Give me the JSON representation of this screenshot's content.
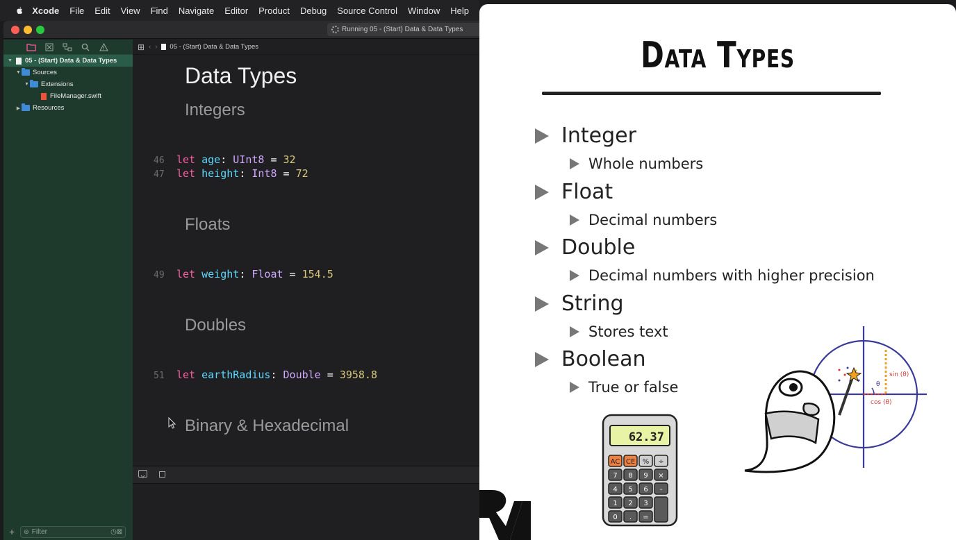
{
  "menubar": {
    "items": [
      "Xcode",
      "File",
      "Edit",
      "View",
      "Find",
      "Navigate",
      "Editor",
      "Product",
      "Debug",
      "Source Control",
      "Window",
      "Help"
    ]
  },
  "toolbar": {
    "status": "Running 05 - (Start) Data & Data Types"
  },
  "navigator": {
    "tree": [
      {
        "label": "05 - (Start) Data & Data Types"
      },
      {
        "label": "Sources"
      },
      {
        "label": "Extensions"
      },
      {
        "label": "FileManager.swift"
      },
      {
        "label": "Resources"
      }
    ],
    "filter_placeholder": "Filter"
  },
  "editor": {
    "breadcrumb": "05 - (Start) Data & Data Types",
    "title": "Data Types",
    "sections": [
      "Integers",
      "Floats",
      "Doubles",
      "Binary & Hexadecimal"
    ],
    "lines": [
      {
        "n": "46",
        "kw": "let",
        "name": "age",
        "type": "UInt8",
        "value": "32"
      },
      {
        "n": "47",
        "kw": "let",
        "name": "height",
        "type": "Int8",
        "value": "72"
      },
      {
        "n": "49",
        "kw": "let",
        "name": "weight",
        "type": "Float",
        "value": "154.5"
      },
      {
        "n": "51",
        "kw": "let",
        "name": "earthRadius",
        "type": "Double",
        "value": "3958.8"
      }
    ]
  },
  "slide": {
    "title": "Data Types",
    "bullets": [
      {
        "label": "Integer",
        "sub": "Whole numbers"
      },
      {
        "label": "Float",
        "sub": "Decimal numbers"
      },
      {
        "label": "Double",
        "sub": "Decimal numbers with higher precision"
      },
      {
        "label": "String",
        "sub": "Stores text"
      },
      {
        "label": "Boolean",
        "sub": "True or false"
      }
    ],
    "calculator": {
      "display": "62.37",
      "keys": [
        "AC",
        "CE",
        "%",
        "÷",
        "7",
        "8",
        "9",
        "×",
        "4",
        "5",
        "6",
        "-",
        "1",
        "2",
        "3",
        "0",
        ".",
        "="
      ]
    },
    "graph": {
      "sin_label": "sin (θ)",
      "cos_label": "cos (θ)",
      "theta": "θ"
    }
  },
  "colors": {
    "keyword": "#fc5fa3",
    "identifier": "#5dd8ff",
    "type": "#d0a8ff",
    "number": "#d9c97c",
    "navigator_bg": "#1e3a2c"
  }
}
